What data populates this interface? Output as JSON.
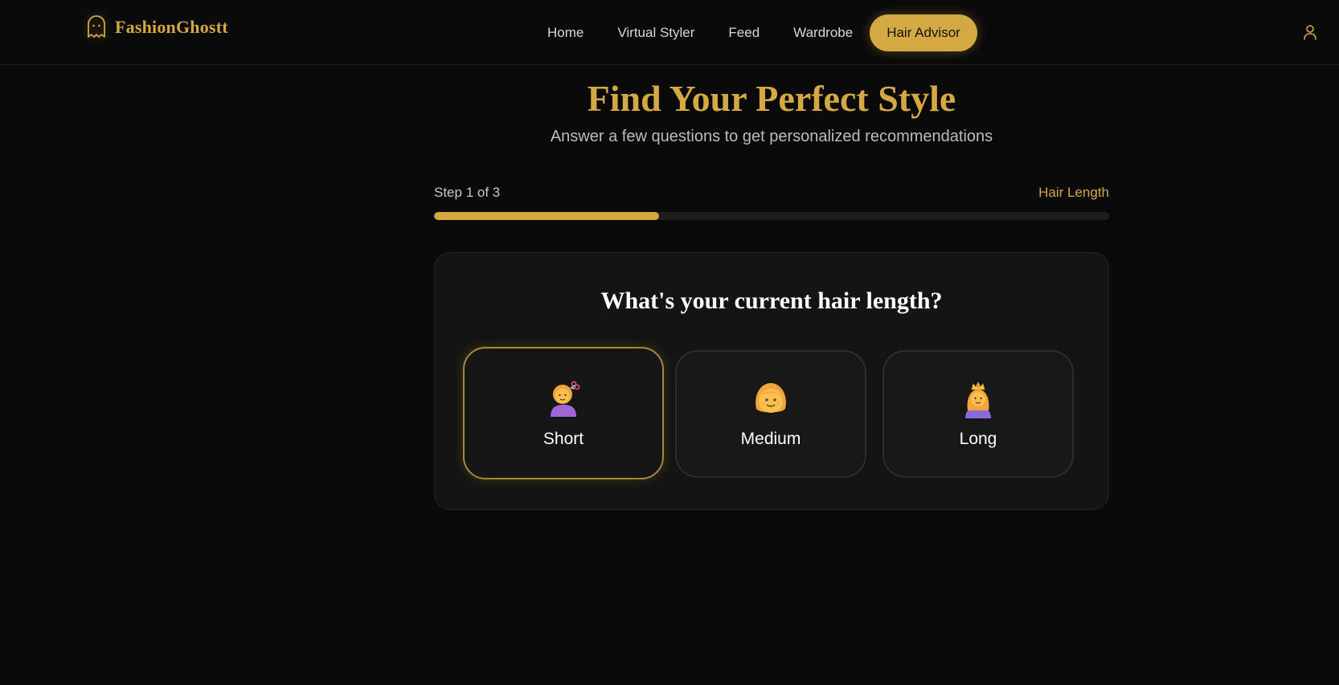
{
  "brand": {
    "name": "FashionGhostt",
    "logo_icon": "ghost-icon",
    "accent_color": "#d4a843"
  },
  "nav": {
    "items": [
      {
        "label": "Home",
        "active": false
      },
      {
        "label": "Virtual Styler",
        "active": false
      },
      {
        "label": "Feed",
        "active": false
      },
      {
        "label": "Wardrobe",
        "active": false
      },
      {
        "label": "Hair Advisor",
        "active": true
      }
    ],
    "user_icon": "user-icon"
  },
  "hero": {
    "title": "Find Your Perfect Style",
    "subtitle": "Answer a few questions to get personalized recommendations"
  },
  "progress": {
    "step_text": "Step 1 of 3",
    "step_name": "Hair Length",
    "fraction": 0.3333
  },
  "question": {
    "title": "What's your current hair length?",
    "options": [
      {
        "label": "Short",
        "icon": "woman-getting-haircut-emoji",
        "selected": true
      },
      {
        "label": "Medium",
        "icon": "woman-emoji",
        "selected": false
      },
      {
        "label": "Long",
        "icon": "princess-emoji",
        "selected": false
      }
    ]
  }
}
